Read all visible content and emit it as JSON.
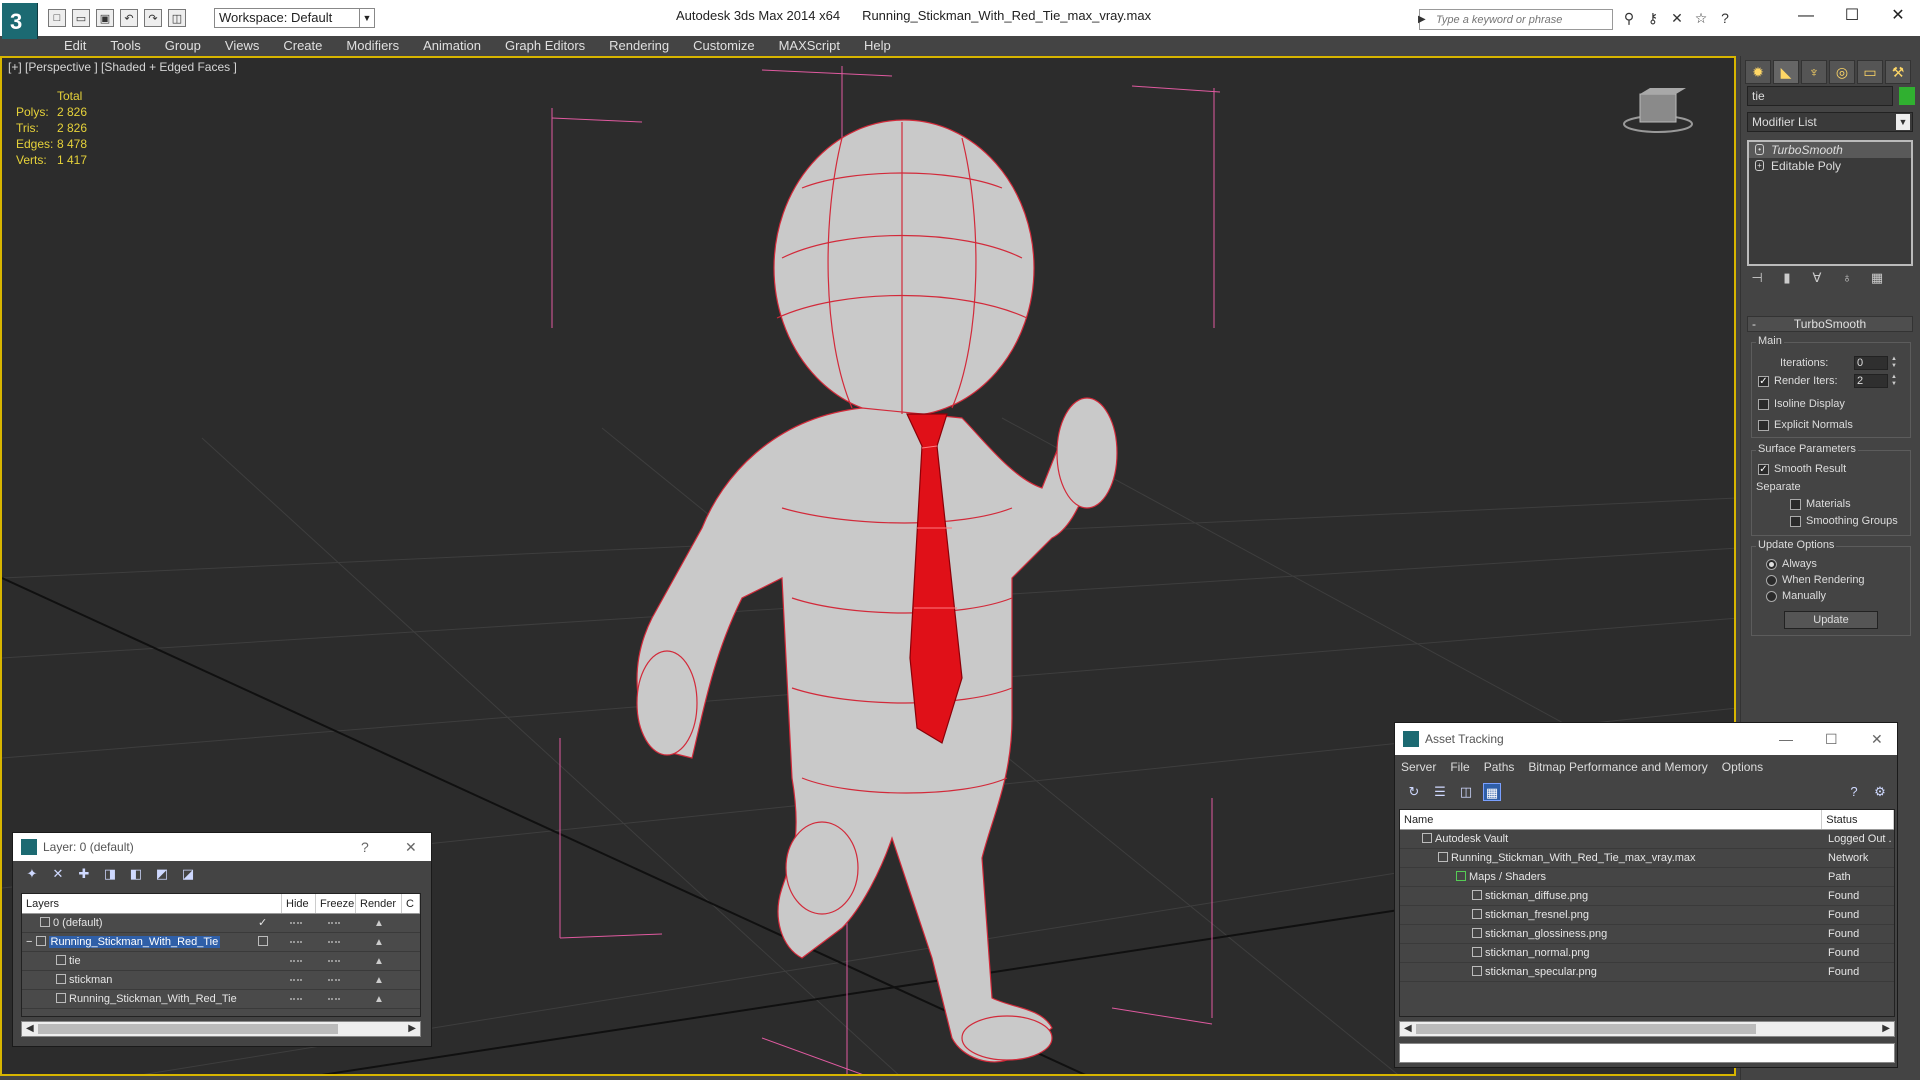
{
  "titlebar": {
    "app_name": "Autodesk 3ds Max  2014 x64",
    "file_name": "Running_Stickman_With_Red_Tie_max_vray.max",
    "workspace": "Workspace: Default",
    "search_placeholder": "Type a keyword or phrase"
  },
  "menu": [
    "Edit",
    "Tools",
    "Group",
    "Views",
    "Create",
    "Modifiers",
    "Animation",
    "Graph Editors",
    "Rendering",
    "Customize",
    "MAXScript",
    "Help"
  ],
  "viewport": {
    "label": "[+] [Perspective ] [Shaded + Edged Faces ]",
    "stats": {
      "total_label": "Total",
      "rows": [
        {
          "key": "Polys:",
          "value": "2 826"
        },
        {
          "key": "Tris:",
          "value": "2 826"
        },
        {
          "key": "Edges:",
          "value": "8 478"
        },
        {
          "key": "Verts:",
          "value": "1 417"
        }
      ]
    },
    "colors": {
      "background": "#2c2c2c",
      "wire": "#d22a3a",
      "tie": "#e01018",
      "border": "#d7b500"
    }
  },
  "command_panel": {
    "object_name": "tie",
    "modifier_list": "Modifier List",
    "stack": [
      "TurboSmooth",
      "Editable Poly"
    ],
    "rollout_title": "TurboSmooth",
    "main": {
      "title": "Main",
      "iterations_label": "Iterations:",
      "iterations_value": "0",
      "render_iters_label": "Render Iters:",
      "render_iters_value": "2",
      "isoline_label": "Isoline Display",
      "explicit_normals_label": "Explicit Normals"
    },
    "surface": {
      "title": "Surface Parameters",
      "smooth_result_label": "Smooth Result",
      "separate_label": "Separate",
      "materials_label": "Materials",
      "smoothing_groups_label": "Smoothing Groups"
    },
    "update": {
      "title": "Update Options",
      "always_label": "Always",
      "when_rendering_label": "When Rendering",
      "manually_label": "Manually",
      "button_label": "Update"
    }
  },
  "layer_window": {
    "title": "Layer: 0 (default)",
    "help": "?",
    "columns": [
      "Layers",
      "Hide",
      "Freeze",
      "Render",
      "C"
    ],
    "rows": [
      {
        "label": "0 (default)"
      },
      {
        "label": "Running_Stickman_With_Red_Tie"
      },
      {
        "label": "tie"
      },
      {
        "label": "stickman"
      },
      {
        "label": "Running_Stickman_With_Red_Tie"
      }
    ]
  },
  "asset_window": {
    "title": "Asset Tracking",
    "menu": [
      "Server",
      "File",
      "Paths",
      "Bitmap Performance and Memory",
      "Options"
    ],
    "columns": [
      "Name",
      "Status"
    ],
    "rows": [
      {
        "name": "Autodesk Vault",
        "status": "Logged Out ."
      },
      {
        "name": "Running_Stickman_With_Red_Tie_max_vray.max",
        "status": "Network Path"
      },
      {
        "name": "Maps / Shaders",
        "status": ""
      },
      {
        "name": "stickman_diffuse.png",
        "status": "Found"
      },
      {
        "name": "stickman_fresnel.png",
        "status": "Found"
      },
      {
        "name": "stickman_glossiness.png",
        "status": "Found"
      },
      {
        "name": "stickman_normal.png",
        "status": "Found"
      },
      {
        "name": "stickman_specular.png",
        "status": "Found"
      }
    ]
  }
}
